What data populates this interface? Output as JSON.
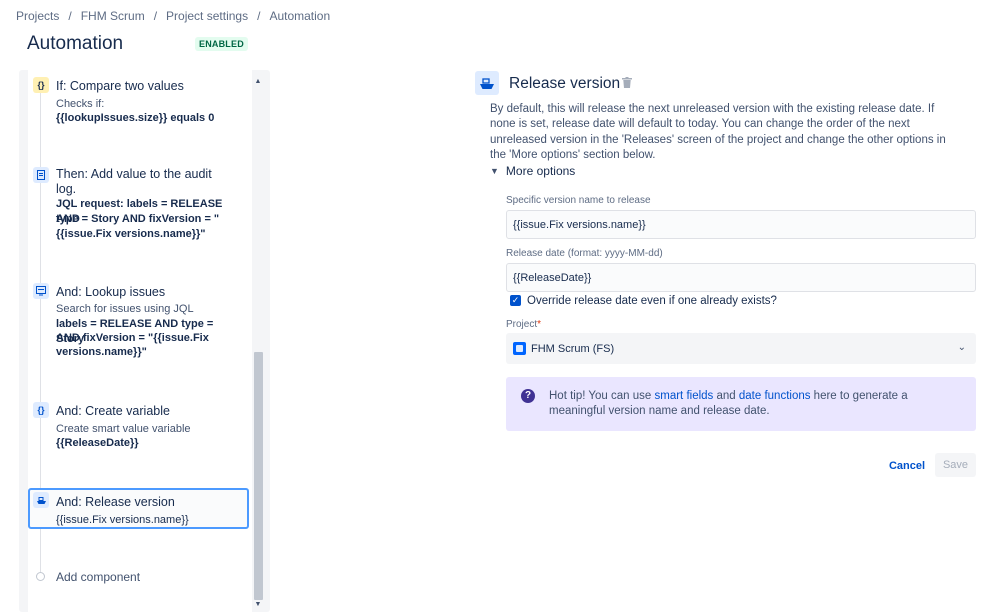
{
  "breadcrumb": {
    "items": [
      "Projects",
      "FHM Scrum",
      "Project settings",
      "Automation"
    ],
    "separator": "/"
  },
  "page": {
    "title": "Automation",
    "status_badge": "ENABLED"
  },
  "rule_steps": {
    "compare": {
      "title": "If: Compare two values",
      "sub": "Checks if:",
      "detail": "{{lookupIssues.size}} equals 0",
      "icon": "curly-braces-icon"
    },
    "audit": {
      "title_line1": "Then: Add value to the audit",
      "title_line2": "log.",
      "detail_l1": "JQL request: labels = RELEASE AND",
      "detail_l2": "type = Story AND fixVersion = \"",
      "detail_l3": "{{issue.Fix versions.name}}\"",
      "icon": "audit-log-icon"
    },
    "lookup": {
      "title": "And: Lookup issues",
      "sub": "Search for issues using JQL",
      "detail_l1": "labels = RELEASE AND type = Story",
      "detail_l2": "AND fixVersion = \"{{issue.Fix",
      "detail_l3": "versions.name}}\"",
      "icon": "lookup-issues-icon"
    },
    "variable": {
      "title": "And: Create variable",
      "sub": "Create smart value variable",
      "detail": "{{ReleaseDate}}",
      "icon": "curly-braces-icon"
    },
    "release": {
      "title": "And: Release version",
      "detail": "{{issue.Fix versions.name}}",
      "icon": "ship-icon"
    },
    "add_component": "Add component"
  },
  "panel": {
    "title": "Release version",
    "description": "By default, this will release the next unreleased version with the existing release date. If none is set, release date will default to today. You can change the order of the next unreleased version in the 'Releases' screen of the project and change the other options in the 'More options' section below.",
    "more_options": "More options",
    "version_label": "Specific version name to release",
    "version_value": "{{issue.Fix versions.name}}",
    "date_label": "Release date (format: yyyy-MM-dd)",
    "date_value": "{{ReleaseDate}}",
    "override_label": "Override release date even if one already exists?",
    "override_checked": true,
    "project_label": "Project",
    "required_marker": "*",
    "project_value": "FHM Scrum (FS)",
    "tip": {
      "prefix": "Hot tip! You can use ",
      "link1": "smart fields",
      "mid": " and ",
      "link2": "date functions",
      "suffix": " here to generate a meaningful version name and release date."
    },
    "cancel": "Cancel",
    "save": "Save"
  },
  "colors": {
    "accent": "#0052cc",
    "enabled_bg": "#e3fcef",
    "enabled_fg": "#006644",
    "tip_bg": "#eae6ff",
    "selected_border": "#4c9aff"
  }
}
